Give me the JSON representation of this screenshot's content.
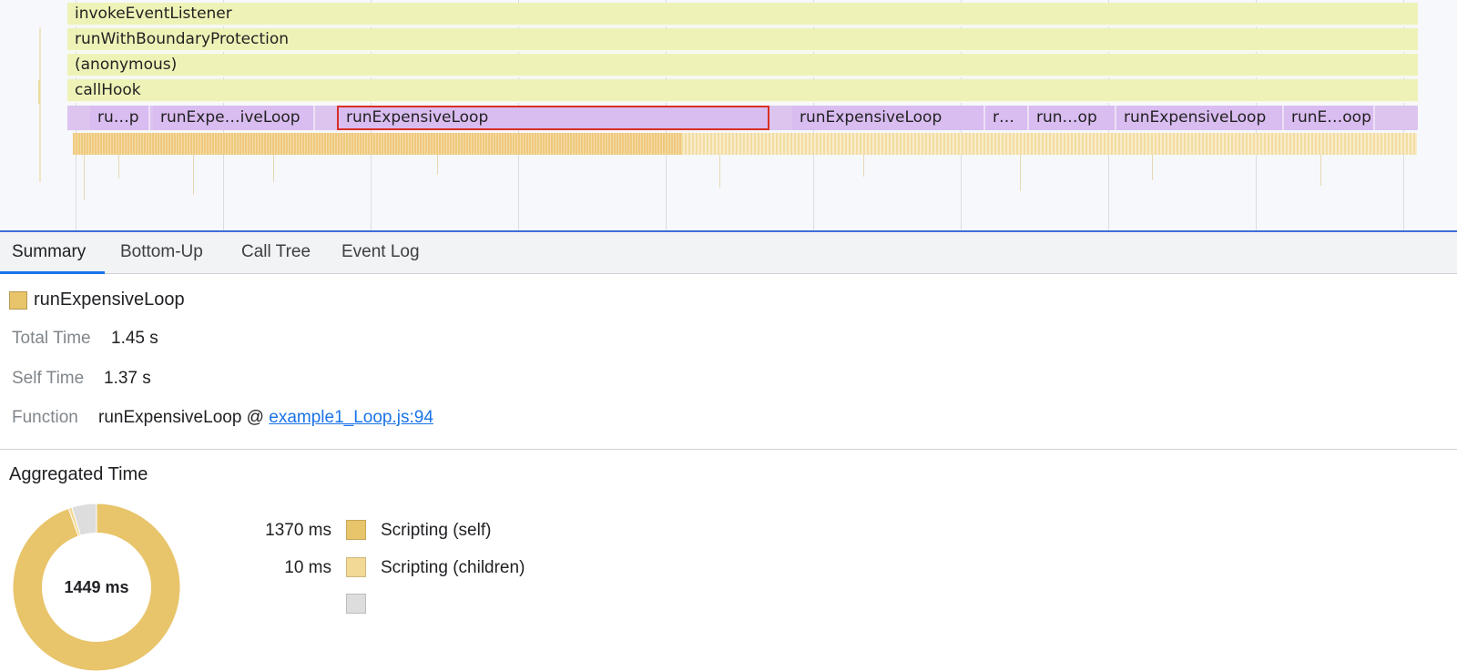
{
  "flame": {
    "lanes": [
      {
        "label": "invokeEventListener"
      },
      {
        "label": "runWithBoundaryProtection"
      },
      {
        "label": "(anonymous)"
      },
      {
        "label": "callHook"
      }
    ],
    "calls": [
      {
        "label": "ru…p"
      },
      {
        "label": "runExpe…iveLoop"
      },
      {
        "label": "runExpensiveLoop"
      },
      {
        "label": "runExpensiveLoop"
      },
      {
        "label": "r…"
      },
      {
        "label": "run…op"
      },
      {
        "label": "runExpensiveLoop"
      },
      {
        "label": "runE…oop"
      }
    ]
  },
  "tabs": [
    {
      "label": "Summary"
    },
    {
      "label": "Bottom-Up"
    },
    {
      "label": "Call Tree"
    },
    {
      "label": "Event Log"
    }
  ],
  "summary": {
    "title": "runExpensiveLoop",
    "title_color": "#e8c46b",
    "total_time_label": "Total Time",
    "total_time": "1.45 s",
    "self_time_label": "Self Time",
    "self_time": "1.37 s",
    "function_label": "Function",
    "function_name": "runExpensiveLoop @",
    "function_link": "example1_Loop.js:94"
  },
  "aggregated": {
    "heading": "Aggregated Time",
    "total_label": "1449 ms",
    "items": [
      {
        "value": "1370 ms",
        "label": "Scripting (self)",
        "ms": 1370,
        "color": "#e8c46b"
      },
      {
        "value": "10 ms",
        "label": "Scripting (children)",
        "ms": 10,
        "color": "#f2d995"
      },
      {
        "value": "",
        "label": "",
        "ms": 69,
        "color": "#dddddd"
      }
    ]
  }
}
